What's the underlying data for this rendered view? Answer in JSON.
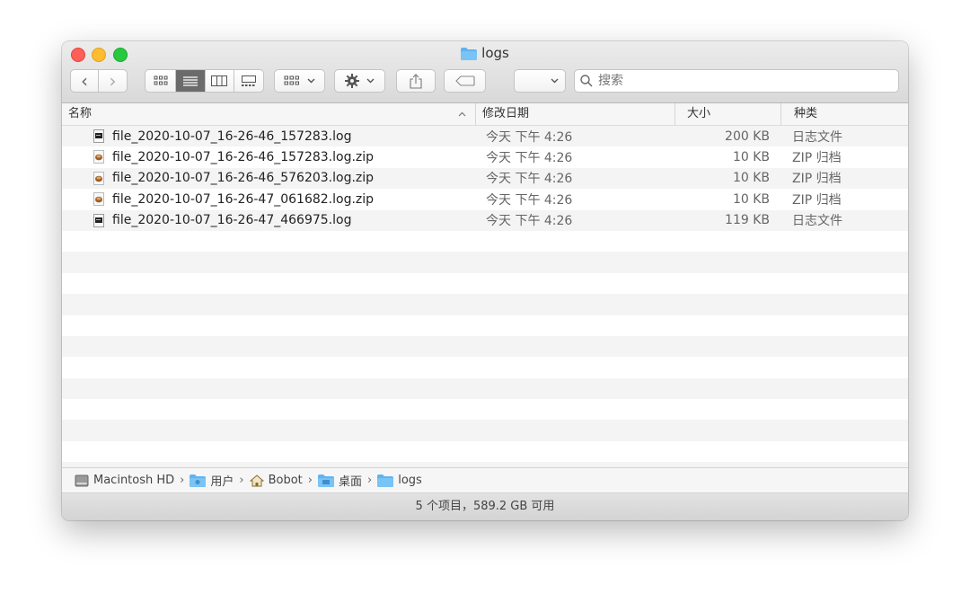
{
  "window": {
    "title": "logs"
  },
  "toolbar": {
    "back_label": "‹",
    "forward_label": "›",
    "search_placeholder": "搜索"
  },
  "columns": {
    "name": "名称",
    "date": "修改日期",
    "size": "大小",
    "kind": "种类"
  },
  "files": [
    {
      "name": "file_2020-10-07_16-26-46_157283.log",
      "date": "今天 下午 4:26",
      "size": "200 KB",
      "kind": "日志文件",
      "icon": "log-file-icon"
    },
    {
      "name": "file_2020-10-07_16-26-46_157283.log.zip",
      "date": "今天 下午 4:26",
      "size": "10 KB",
      "kind": "ZIP 归档",
      "icon": "zip-archive-icon"
    },
    {
      "name": "file_2020-10-07_16-26-46_576203.log.zip",
      "date": "今天 下午 4:26",
      "size": "10 KB",
      "kind": "ZIP 归档",
      "icon": "zip-archive-icon"
    },
    {
      "name": "file_2020-10-07_16-26-47_061682.log.zip",
      "date": "今天 下午 4:26",
      "size": "10 KB",
      "kind": "ZIP 归档",
      "icon": "zip-archive-icon"
    },
    {
      "name": "file_2020-10-07_16-26-47_466975.log",
      "date": "今天 下午 4:26",
      "size": "119 KB",
      "kind": "日志文件",
      "icon": "log-file-icon"
    }
  ],
  "path": [
    {
      "label": "Macintosh HD",
      "icon": "hard-drive-icon"
    },
    {
      "label": "用户",
      "icon": "users-folder-icon"
    },
    {
      "label": "Bobot",
      "icon": "home-icon"
    },
    {
      "label": "桌面",
      "icon": "desktop-folder-icon"
    },
    {
      "label": "logs",
      "icon": "folder-icon"
    }
  ],
  "status": {
    "text": "5 个项目，589.2 GB 可用"
  },
  "colors": {
    "folder": "#5fb3f0",
    "selected_view": "#6b6b6b",
    "row_stripe": "#f4f4f4"
  }
}
